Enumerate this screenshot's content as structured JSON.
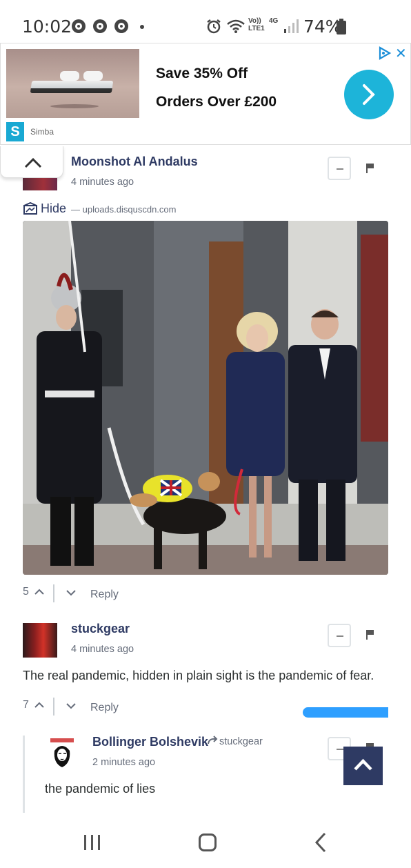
{
  "status_bar": {
    "time": "10:02",
    "network_label_top": "Vo))",
    "network_label_bottom": "LTE1",
    "network_type": "4G",
    "battery": "74%"
  },
  "ad": {
    "headline": "Save 35% Off",
    "subline": "Orders Over £200",
    "brand_badge": "S",
    "brand": "Simba",
    "close_glyph": "✕"
  },
  "comments": [
    {
      "author": "Moonshot Al Andalus",
      "time": "4 minutes ago",
      "hide_label": "Hide",
      "media_source": "— uploads.disquscdn.com",
      "votes": "5",
      "reply_label": "Reply"
    },
    {
      "author": "stuckgear",
      "time": "4 minutes ago",
      "text": "The real pandemic, hidden in plain sight is the pandemic of fear.",
      "votes": "7",
      "reply_label": "Reply"
    },
    {
      "author": "Bollinger Bolshevik",
      "reply_to": "stuckgear",
      "time": "2 minutes ago",
      "text": "the pandemic of lies"
    }
  ],
  "icons": {
    "collapse": "chevron-up-icon",
    "scroll_top": "chevron-up-icon",
    "flag": "flag-icon",
    "reply_arrow": "share-arrow-icon",
    "hide": "image-hide-icon"
  },
  "colors": {
    "author": "#2e3a63",
    "accent_blue": "#2e9fff",
    "ad_button": "#1db4d9",
    "scroll_button": "#2e3a63"
  }
}
